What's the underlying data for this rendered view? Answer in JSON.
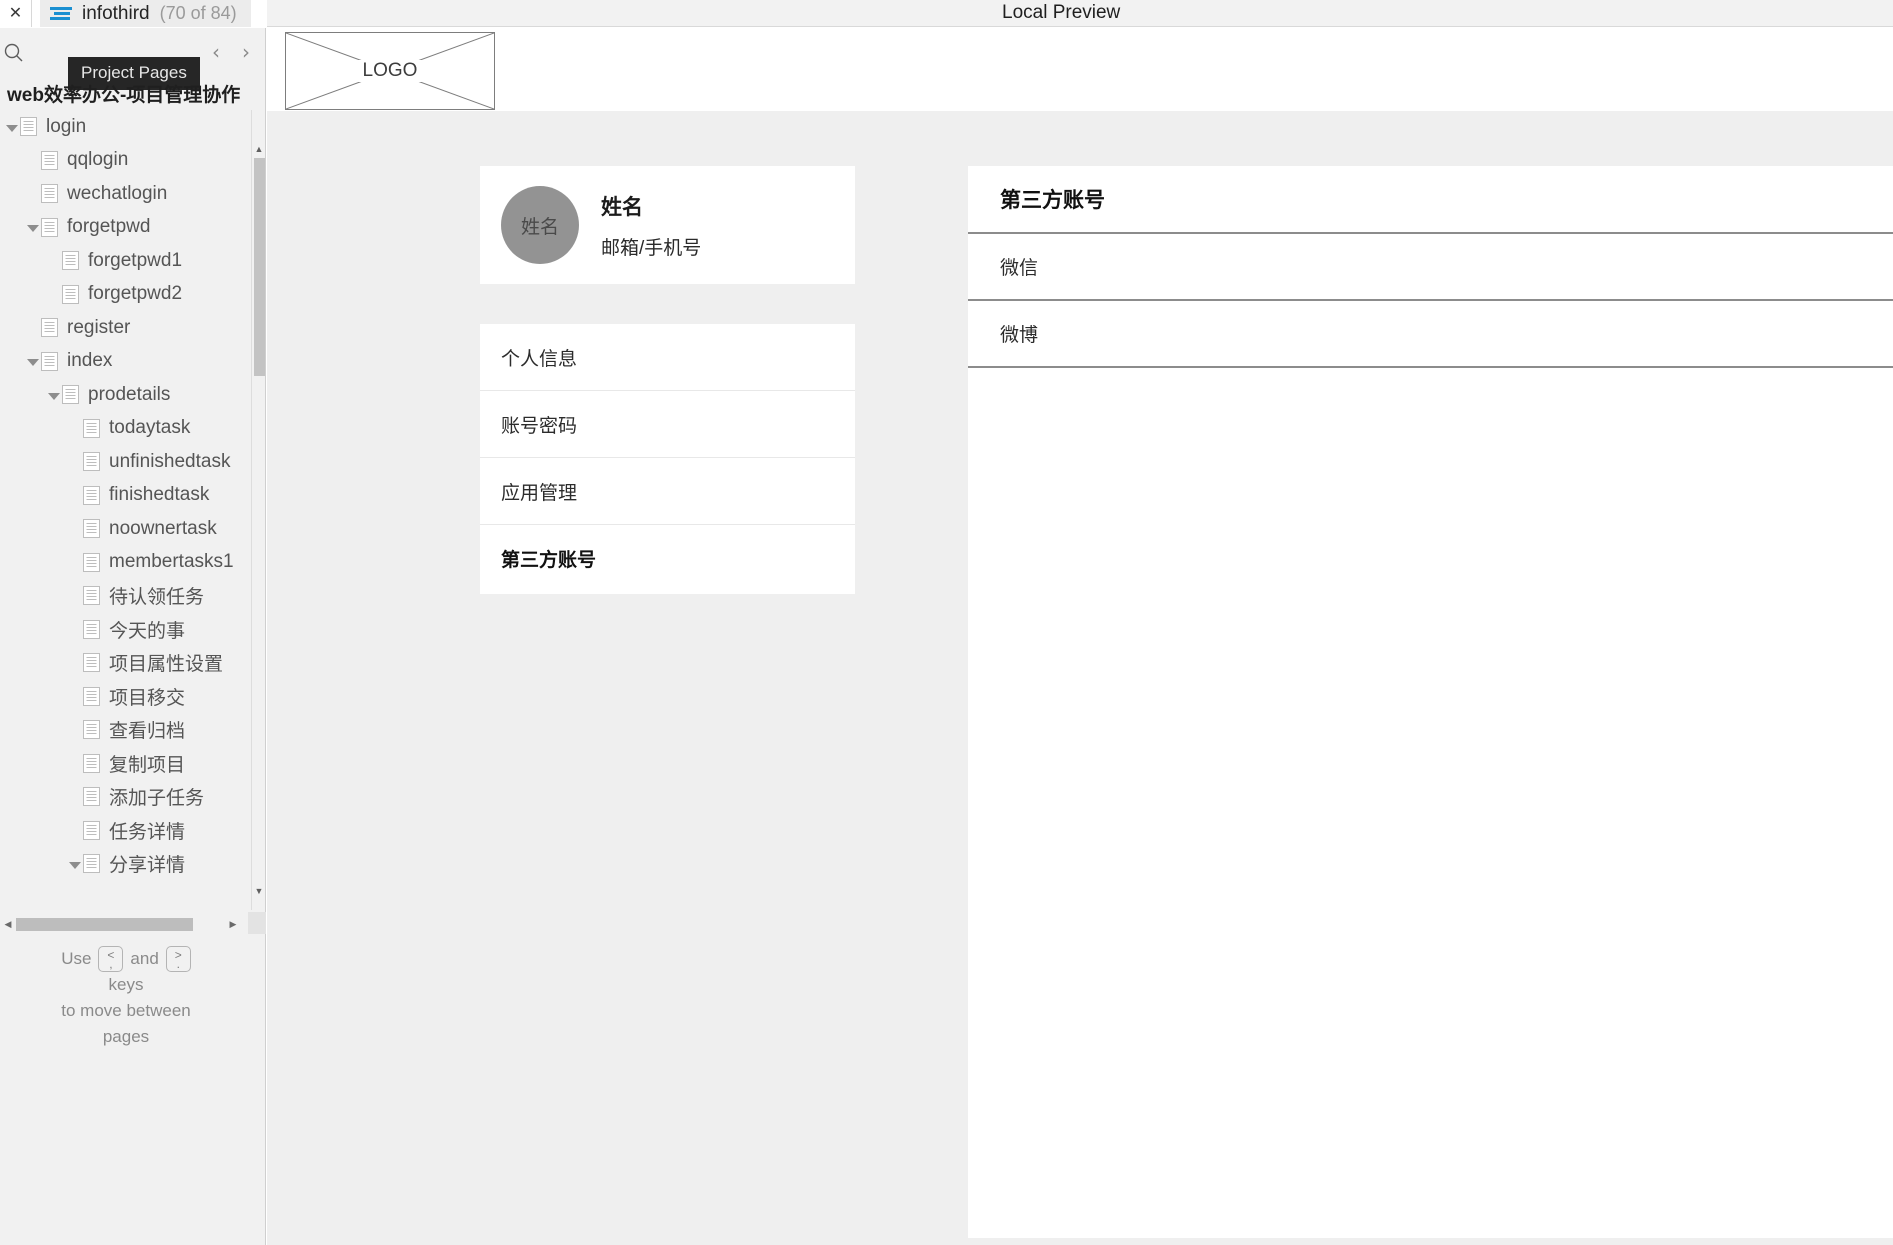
{
  "tabstrip": {
    "close_label": "✕",
    "tab_title": "infothird",
    "tab_count": "(70 of 84)"
  },
  "sidebar": {
    "tooltip": "Project Pages",
    "prev_label": "‹",
    "next_label": "›",
    "project_title": "web效率办公-项目管理协作",
    "tree": [
      {
        "label": "login",
        "depth": 0,
        "twisty": "open"
      },
      {
        "label": "qqlogin",
        "depth": 1,
        "twisty": "none"
      },
      {
        "label": "wechatlogin",
        "depth": 1,
        "twisty": "none"
      },
      {
        "label": "forgetpwd",
        "depth": 1,
        "twisty": "open"
      },
      {
        "label": "forgetpwd1",
        "depth": 2,
        "twisty": "none"
      },
      {
        "label": "forgetpwd2",
        "depth": 2,
        "twisty": "none"
      },
      {
        "label": "register",
        "depth": 1,
        "twisty": "none"
      },
      {
        "label": "index",
        "depth": 1,
        "twisty": "open"
      },
      {
        "label": "prodetails",
        "depth": 2,
        "twisty": "open"
      },
      {
        "label": "todaytask",
        "depth": 3,
        "twisty": "none"
      },
      {
        "label": "unfinishedtask",
        "depth": 3,
        "twisty": "none"
      },
      {
        "label": "finishedtask",
        "depth": 3,
        "twisty": "none"
      },
      {
        "label": "noownertask",
        "depth": 3,
        "twisty": "none"
      },
      {
        "label": "membertasks1",
        "depth": 3,
        "twisty": "none"
      },
      {
        "label": "待认领任务",
        "depth": 3,
        "twisty": "none"
      },
      {
        "label": "今天的事",
        "depth": 3,
        "twisty": "none"
      },
      {
        "label": "项目属性设置",
        "depth": 3,
        "twisty": "none"
      },
      {
        "label": "项目移交",
        "depth": 3,
        "twisty": "none"
      },
      {
        "label": "查看归档",
        "depth": 3,
        "twisty": "none"
      },
      {
        "label": "复制项目",
        "depth": 3,
        "twisty": "none"
      },
      {
        "label": "添加子任务",
        "depth": 3,
        "twisty": "none"
      },
      {
        "label": "任务详情",
        "depth": 3,
        "twisty": "none"
      },
      {
        "label": "分享详情",
        "depth": 3,
        "twisty": "open"
      }
    ],
    "hint": {
      "use": "Use",
      "key_prev_top": "<",
      "key_prev_bottom": ",",
      "and": "and",
      "key_next_top": ">",
      "key_next_bottom": ".",
      "keys": "keys",
      "line3": "to move between",
      "line4": "pages"
    }
  },
  "preview": {
    "title": "Local Preview",
    "logo_text": "LOGO"
  },
  "main": {
    "profile": {
      "avatar_text": "姓名",
      "name": "姓名",
      "contact": "邮箱/手机号"
    },
    "menu": [
      {
        "label": "个人信息",
        "active": false
      },
      {
        "label": "账号密码",
        "active": false
      },
      {
        "label": "应用管理",
        "active": false
      },
      {
        "label": "第三方账号",
        "active": true
      }
    ],
    "panel": {
      "title": "第三方账号",
      "rows": [
        {
          "label": "微信"
        },
        {
          "label": "微博"
        }
      ]
    }
  },
  "colors": {
    "accent": "#1a8fd1",
    "page_bg": "#efefef",
    "sidebar_bg": "#f1f1f1",
    "avatar_bg": "#939393"
  }
}
